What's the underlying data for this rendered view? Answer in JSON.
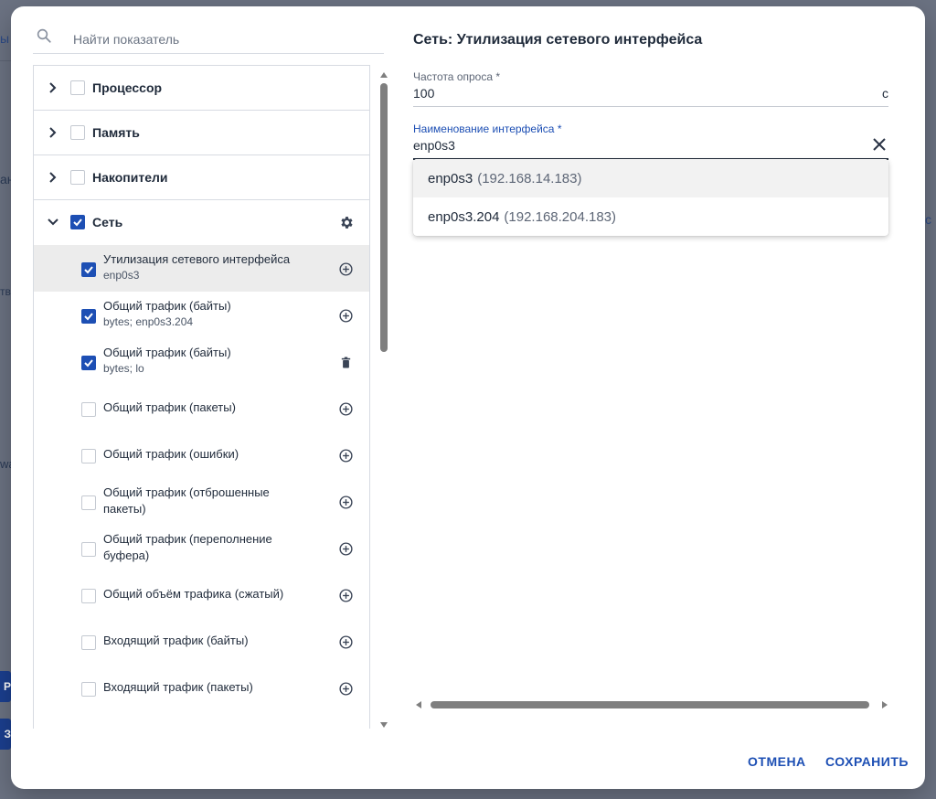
{
  "backdrop": {
    "fragments": [
      "ы",
      "ан",
      "тв",
      "wa",
      "с"
    ],
    "buttons": [
      "Р",
      "З"
    ]
  },
  "search": {
    "placeholder": "Найти показатель"
  },
  "categories": [
    {
      "label": "Процессор",
      "checked": false,
      "expanded": false
    },
    {
      "label": "Память",
      "checked": false,
      "expanded": false
    },
    {
      "label": "Накопители",
      "checked": false,
      "expanded": false
    },
    {
      "label": "Сеть",
      "checked": true,
      "expanded": true
    }
  ],
  "items": [
    {
      "title": "Утилизация сетевого интерфейса",
      "sub": "enp0s3",
      "checked": true,
      "action": "add",
      "selected": true
    },
    {
      "title": "Общий трафик (байты)",
      "sub": "bytes; enp0s3.204",
      "checked": true,
      "action": "add"
    },
    {
      "title": "Общий трафик (байты)",
      "sub": "bytes; lo",
      "checked": true,
      "action": "delete"
    },
    {
      "title": "Общий трафик (пакеты)",
      "sub": "",
      "checked": false,
      "action": "add"
    },
    {
      "title": "Общий трафик (ошибки)",
      "sub": "",
      "checked": false,
      "action": "add"
    },
    {
      "title": "Общий трафик (отброшенные пакеты)",
      "sub": "",
      "checked": false,
      "action": "add"
    },
    {
      "title": "Общий трафик (переполнение буфера)",
      "sub": "",
      "checked": false,
      "action": "add"
    },
    {
      "title": "Общий объём трафика (сжатый)",
      "sub": "",
      "checked": false,
      "action": "add"
    },
    {
      "title": "Входящий трафик (байты)",
      "sub": "",
      "checked": false,
      "action": "add"
    },
    {
      "title": "Входящий трафик (пакеты)",
      "sub": "",
      "checked": false,
      "action": "add"
    }
  ],
  "panel": {
    "title": "Сеть: Утилизация сетевого интерфейса",
    "poll": {
      "label": "Частота опроса *",
      "value": "100",
      "unit": "с"
    },
    "iface": {
      "label": "Наименование интерфейса *",
      "value": "enp0s3"
    },
    "options": [
      {
        "name": "enp0s3",
        "ip": "(192.168.14.183)"
      },
      {
        "name": "enp0s3.204",
        "ip": "(192.168.204.183)"
      }
    ]
  },
  "actions": {
    "cancel": "ОТМЕНА",
    "save": "СОХРАНИТЬ"
  },
  "colors": {
    "accent": "#1d4fb4",
    "backdrop": "#6b7282",
    "selectedRow": "#ececec"
  }
}
